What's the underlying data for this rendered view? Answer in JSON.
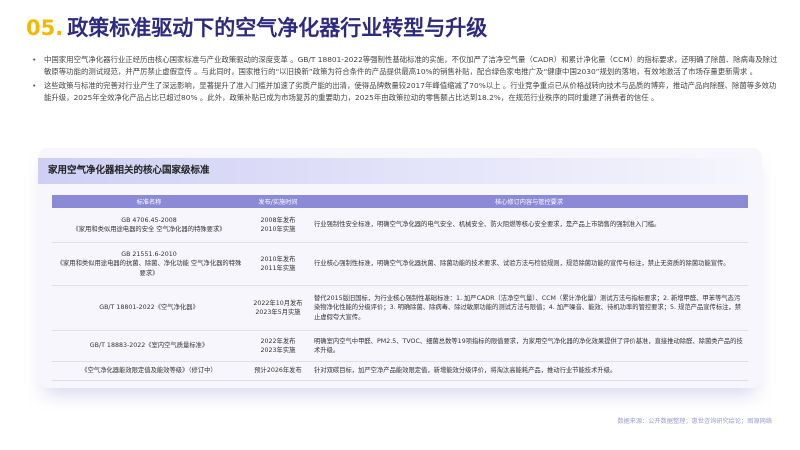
{
  "header": {
    "number": "05.",
    "title": "政策标准驱动下的空气净化器行业转型与升级"
  },
  "bullets": [
    "中国家用空气净化器行业正经历由核心国家标准与产业政策驱动的深度变革 。GB/T 18801-2022等强制性基础标准的实施，不仅加严了洁净空气量（CADR）和累计净化量（CCM）的指标要求，还明确了除菌、除病毒及除过敏原等功能的测试规范，并严厉禁止虚假宣传 。与此同时，国家推行的“以旧换新”政策为符合条件的产品提供最高10%的销售补贴，配合绿色家电推广及“健康中国2030”规划的落地，有效地激活了市场存量更新需求 。",
    "这些政策与标准的完善对行业产生了深远影响，显著提升了准入门槛并加速了劣质产能的出清，使得品牌数量较2017年峰值缩减了70%以上 。行业竞争重点已从价格战转向技术与品质的博弈，推动产品向除醛、除菌等多效功能升级，2025年全效净化产品占比已超过80% 。此外，政策补贴已成为市场复苏的重要助力，2025年由政策拉动的零售额占比达到18.2%，在规范行业秩序的同时重建了消费者的信任 。"
  ],
  "table": {
    "title": "家用空气净化器相关的核心国家级标准",
    "headers": [
      "标准名称",
      "发布/实施时间",
      "核心修订内容与管控要求"
    ],
    "rows": [
      {
        "std": "GB 4706.45-2008\n《家用和类似用途电器的安全 空气净化器的特殊要求》",
        "date": "2008年发布\n2010年实施",
        "desc": "行业强制性安全标准，明确空气净化器的电气安全、机械安全、防火阻燃等核心安全要求，是产品上市销售的强制准入门槛。"
      },
      {
        "std": "GB 21551.6-2010\n《家用和类似用途电器的抗菌、除菌、净化功能 空气净化器的特殊要求》",
        "date": "2010年发布\n2011年实施",
        "desc": "行业核心强制性标准，明确空气净化器抗菌、除菌功能的技术要求、试验方法与检验规则，规范除菌功能的宣传与标注，禁止无资质的除菌功能宣传。"
      },
      {
        "std": "GB/T 18801-2022《空气净化器》",
        "date": "2022年10月发布\n2023年5月实施",
        "desc": "替代2015版旧国标，为行业核心强制性基础标准：1. 加严CADR（洁净空气量）、CCM（累计净化量）测试方法与指标要求；2. 新增甲醛、甲苯等气态污染物净化性能的分级评价；3. 明确除菌、除病毒、除过敏原功能的测试方法与限值；4. 加严噪音、能效、待机功率的管控要求；5. 规范产品宣传标注，禁止虚假夸大宣传。"
      },
      {
        "std": "GB/T 18883-2022《室内空气质量标准》",
        "date": "2022年发布\n2023年实施",
        "desc": "明确室内空气中甲醛、PM2.5、TVOC、细菌总数等19项指标的限值要求，为家用空气净化器的净化效果提供了评价基准，直接推动除醛、除菌类产品的技术升级。"
      },
      {
        "std": "《空气净化器能效限定值及能效等级》（修订中）",
        "date": "预计2026年发布",
        "desc": "针对双碳目标，加严空净产品能效限定值，新增能效分级评价，将淘汰高能耗产品，推动行业节能技术升级。"
      }
    ]
  },
  "source": "数据来源：公开数据整理；惠世咨询研究绘论；图源网络"
}
